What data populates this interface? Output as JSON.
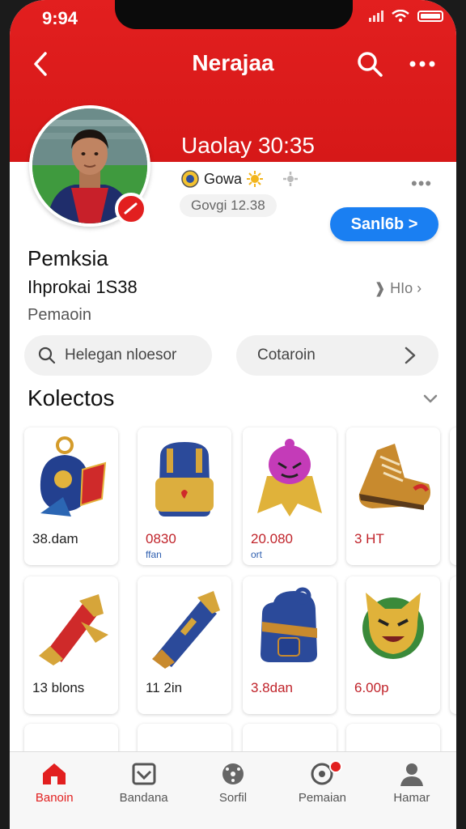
{
  "status_bar": {
    "time": "9:94"
  },
  "nav": {
    "title": "Nerajaa"
  },
  "header": {
    "tagline": "Uaolay 30:35"
  },
  "profile": {
    "team": "Gowa",
    "stat": "Govgi 12.38",
    "follow_label": "Sanl6b >",
    "name": "Pemksia",
    "id_line": "Ihprokai 1S38",
    "role": "Pemaoin",
    "side_link": "HIo"
  },
  "search": {
    "placeholder": "Helegan nloesor"
  },
  "filter": {
    "label": "Cotaroin"
  },
  "section": {
    "title": "Kolectos"
  },
  "items": [
    {
      "price": "38.dam",
      "sub": "",
      "icon": "medal-bag-icon"
    },
    {
      "price": "0830",
      "sub": "ffan",
      "icon": "backpack-icon"
    },
    {
      "price": "20.080",
      "sub": "ort",
      "icon": "mascot-cape-icon"
    },
    {
      "price": "3 HT",
      "sub": "",
      "icon": "boot-icon"
    },
    {
      "price": "13 blons",
      "sub": "",
      "icon": "red-bat-icon"
    },
    {
      "price": "11 2in",
      "sub": "",
      "icon": "blue-bat-icon"
    },
    {
      "price": "3.8dan",
      "sub": "",
      "icon": "blue-backpack-icon"
    },
    {
      "price": "6.00p",
      "sub": "",
      "icon": "cat-emblem-icon"
    }
  ],
  "tabbar": [
    {
      "label": "Banoin",
      "icon": "home-icon",
      "active": true
    },
    {
      "label": "Bandana",
      "icon": "inbox-icon",
      "active": false
    },
    {
      "label": "Sorfil",
      "icon": "ball-icon",
      "active": false
    },
    {
      "label": "Pemaian",
      "icon": "target-icon",
      "active": false
    },
    {
      "label": "Hamar",
      "icon": "user-icon",
      "active": false
    }
  ],
  "colors": {
    "brand_red": "#e21f1f",
    "accent_blue": "#1a7ff2"
  }
}
